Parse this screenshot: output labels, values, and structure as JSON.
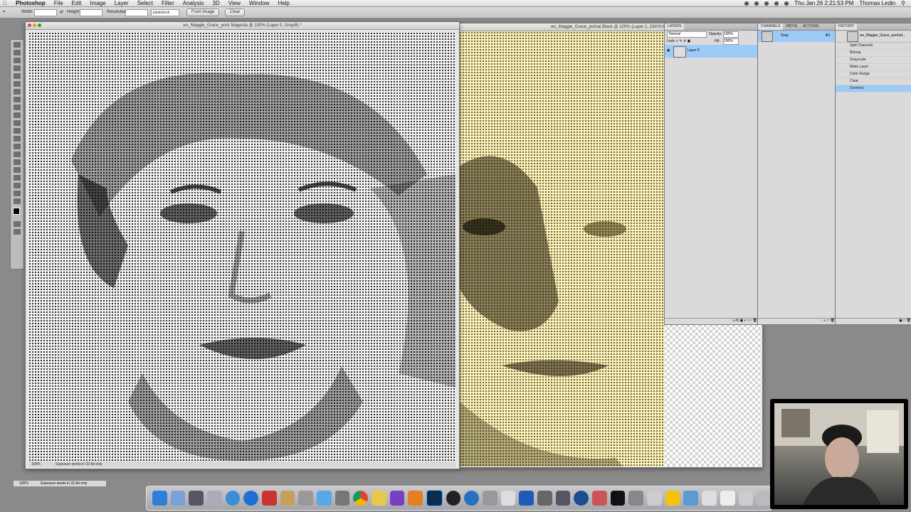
{
  "menubar": {
    "app_name": "Photoshop",
    "menus": [
      "File",
      "Edit",
      "Image",
      "Layer",
      "Select",
      "Filter",
      "Analysis",
      "3D",
      "View",
      "Window",
      "Help"
    ],
    "clock": "Thu Jan 26  2:21:53 PM",
    "user": "Thomas Ledin"
  },
  "options_bar": {
    "width_label": "Width:",
    "height_label": "Height:",
    "resolution_label": "Resolution:",
    "unit_select": "pixels/inch",
    "front_image_button": "Front Image",
    "clear_button": "Clear"
  },
  "doc_left": {
    "title": "ws_Maggie_Grace_portr Magenta @ 100% (Layer 0, Gray/8) *",
    "zoom": "100%",
    "status": "Exposure works in 32-bit only"
  },
  "doc_right": {
    "title": "ws_Maggie_Grace_portrai Black @ 100% (Layer 2, CMYK/8) *"
  },
  "app_status": {
    "zoom": "100%",
    "status": "Exposure works in 32-bit only"
  },
  "layers_panel": {
    "tab": "LAYERS",
    "blend_mode": "Normal",
    "opacity_label": "Opacity:",
    "opacity_value": "100%",
    "lock_label": "Lock:",
    "fill_label": "Fill:",
    "fill_value": "100%",
    "layer_name": "Layer 0"
  },
  "channels_panel": {
    "tabs": [
      "CHANNELS",
      "PATHS",
      "ACTIONS"
    ],
    "channel_name": "Gray",
    "channel_shortcut": "⌘1"
  },
  "history_panel": {
    "tab": "HISTORY",
    "snapshot": "ws_Maggie_Grace_portrait...",
    "items": [
      "Split Channels",
      "Bitmap",
      "Grayscale",
      "Make Layer",
      "Color Range",
      "Clear",
      "Deselect"
    ],
    "selected_index": 6
  },
  "colors": {
    "selection_blue": "#9dcbf7",
    "halftone_yellow": "#fbf5c4"
  }
}
